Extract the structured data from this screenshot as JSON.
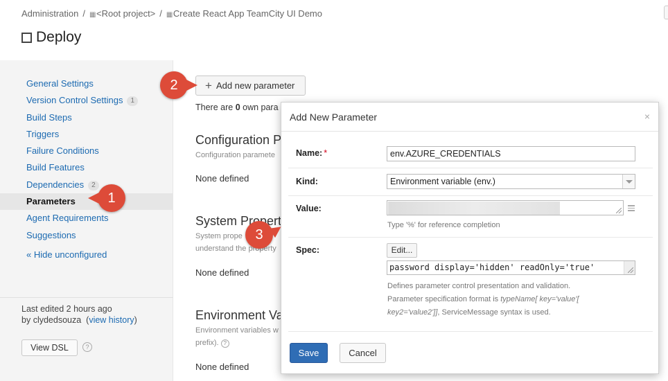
{
  "breadcrumbs": {
    "administration": "Administration",
    "sep1": "/",
    "root_icon": "project-grid-icon",
    "root": "<Root project>",
    "sep2": "/",
    "project_icon": "project-grid-icon",
    "project": "Create React App TeamCity UI Demo"
  },
  "page": {
    "title": "Deploy",
    "title_icon": "build-config-square-icon"
  },
  "sidebar": {
    "items": [
      {
        "label": "General Settings",
        "badge": ""
      },
      {
        "label": "Version Control Settings",
        "badge": "1"
      },
      {
        "label": "Build Steps",
        "badge": ""
      },
      {
        "label": "Triggers",
        "badge": ""
      },
      {
        "label": "Failure Conditions",
        "badge": ""
      },
      {
        "label": "Build Features",
        "badge": ""
      },
      {
        "label": "Dependencies",
        "badge": "2"
      },
      {
        "label": "Parameters",
        "badge": "",
        "active": true
      },
      {
        "label": "Agent Requirements",
        "badge": ""
      },
      {
        "label": "Suggestions",
        "badge": ""
      }
    ],
    "hide_unconfigured": "« Hide unconfigured",
    "last_edited_prefix": "Last edited",
    "last_edited_time": "2 hours ago",
    "by": "by",
    "user": "clydedsouza",
    "view_history_open": "(",
    "view_history": "view history",
    "view_history_close": ")",
    "view_dsl": "View DSL",
    "help": "?"
  },
  "main": {
    "add_button": "Add new parameter",
    "add_icon": "+",
    "own_params_prefix": "There are",
    "own_params_count": "0",
    "own_params_suffix": "own para",
    "sections": [
      {
        "title": "Configuration P",
        "desc_lines": [
          "Configuration paramete"
        ],
        "none": "None defined"
      },
      {
        "title": "System Properti",
        "desc_lines": [
          "System prope",
          "understand the property"
        ],
        "none": "None defined"
      },
      {
        "title": "Environment Va",
        "desc_lines": [
          "Environment variables w",
          "prefix)."
        ],
        "help": "?",
        "none": "None defined"
      }
    ]
  },
  "markers": {
    "m1": "1",
    "m2": "2",
    "m3": "3"
  },
  "modal": {
    "title": "Add New Parameter",
    "close": "×",
    "name_label": "Name:",
    "required_mark": "*",
    "name_value": "env.AZURE_CREDENTIALS",
    "kind_label": "Kind:",
    "kind_value": "Environment variable (env.)",
    "value_label": "Value:",
    "value_hint": "Type '%' for reference completion",
    "spec_label": "Spec:",
    "edit_button": "Edit...",
    "spec_value": "password display='hidden' readOnly='true'",
    "spec_desc_1": "Defines parameter control presentation and validation.",
    "spec_desc_2a": "Parameter specification format is ",
    "spec_desc_2b": "typeName[ key='value'[",
    "spec_desc_3a": "key2='value2']]",
    "spec_desc_3b": ", ServiceMessage syntax is used.",
    "save": "Save",
    "cancel": "Cancel"
  },
  "colors": {
    "accent": "#2f6db5",
    "link": "#1c6ab1",
    "marker": "#dd4b39",
    "required": "#d0021b"
  }
}
